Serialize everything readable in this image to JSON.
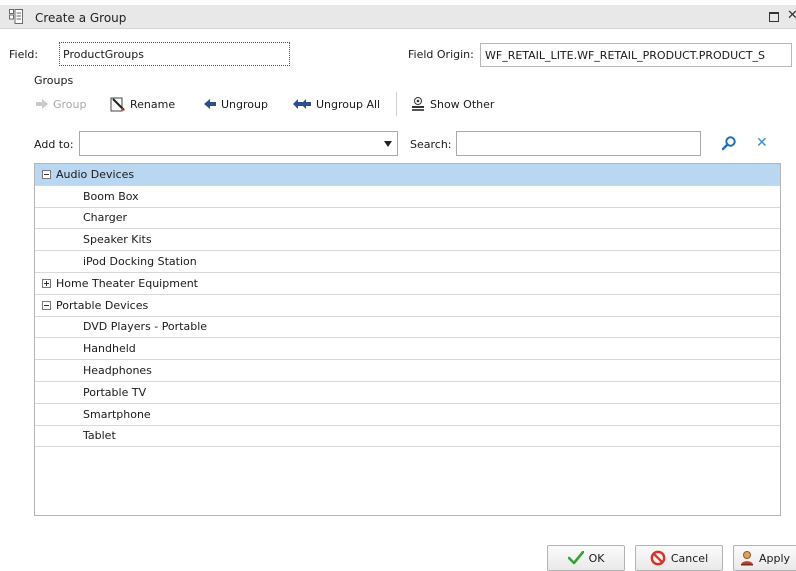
{
  "window": {
    "title": "Create a Group"
  },
  "field": {
    "label": "Field:",
    "value": "ProductGroups"
  },
  "field_origin": {
    "label": "Field Origin:",
    "value": "WF_RETAIL_LITE.WF_RETAIL_PRODUCT.PRODUCT_S"
  },
  "groups_label": "Groups",
  "toolbar": {
    "group_label": "Group",
    "rename_label": "Rename",
    "ungroup_label": "Ungroup",
    "ungroup_all_label": "Ungroup All",
    "show_other_label": "Show Other"
  },
  "add_to": {
    "label": "Add to:",
    "value": ""
  },
  "search": {
    "label": "Search:",
    "value": ""
  },
  "tree": {
    "rows": [
      {
        "label": "Audio Devices",
        "kind": "group",
        "state": "expanded",
        "selected": true
      },
      {
        "label": "Boom Box",
        "kind": "item"
      },
      {
        "label": "Charger",
        "kind": "item"
      },
      {
        "label": "Speaker Kits",
        "kind": "item"
      },
      {
        "label": "iPod Docking Station",
        "kind": "item"
      },
      {
        "label": "Home Theater Equipment",
        "kind": "group",
        "state": "collapsed"
      },
      {
        "label": "Portable Devices",
        "kind": "group",
        "state": "expanded"
      },
      {
        "label": "DVD Players - Portable",
        "kind": "item"
      },
      {
        "label": "Handheld",
        "kind": "item"
      },
      {
        "label": "Headphones",
        "kind": "item"
      },
      {
        "label": "Portable TV",
        "kind": "item"
      },
      {
        "label": "Smartphone",
        "kind": "item"
      },
      {
        "label": "Tablet",
        "kind": "item"
      }
    ]
  },
  "footer": {
    "ok_label": "OK",
    "cancel_label": "Cancel",
    "apply_label": "Apply"
  },
  "colors": {
    "selected_row": "#b9d7f1",
    "ok_check": "#3aa13a",
    "cancel_red": "#d9322b",
    "search_blue": "#1f6fb4"
  }
}
